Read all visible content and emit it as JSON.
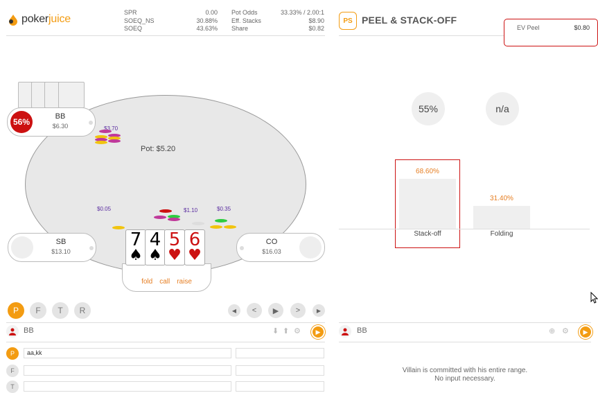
{
  "app": {
    "logo_text_poker": "poker",
    "logo_text_juice": "juice"
  },
  "stats_left": [
    {
      "label": "SPR",
      "value": "0.00"
    },
    {
      "label": "SOEQ_NS",
      "value": "30.88%"
    },
    {
      "label": "SOEQ",
      "value": "43.63%"
    }
  ],
  "stats_right": [
    {
      "label": "Pot Odds",
      "value": "33.33% / 2.00:1"
    },
    {
      "label": "Eff. Stacks",
      "value": "$8.90"
    },
    {
      "label": "Share",
      "value": "$0.82"
    }
  ],
  "table": {
    "pot": "Pot: $5.20",
    "seats": {
      "bb": {
        "name": "BB",
        "stack": "$6.30",
        "equity": "56%"
      },
      "sb": {
        "name": "SB",
        "stack": "$13.10"
      },
      "co": {
        "name": "CO",
        "stack": "$16.03"
      }
    },
    "bets": {
      "bb": "$3.70",
      "sb": "$0.05",
      "mid": "$1.10",
      "co": "$0.35"
    },
    "board": [
      {
        "rank": "7",
        "suit": "♠",
        "color": "#000000"
      },
      {
        "rank": "4",
        "suit": "♠",
        "color": "#000000"
      },
      {
        "rank": "5",
        "suit": "♥",
        "color": "#cc1111"
      },
      {
        "rank": "6",
        "suit": "♥",
        "color": "#cc1111"
      }
    ],
    "actions": {
      "fold": "fold",
      "call": "call",
      "raise": "raise"
    }
  },
  "streets": [
    "P",
    "F",
    "T",
    "R"
  ],
  "left_panel": {
    "player": "BB",
    "ranges": [
      {
        "label": "P",
        "value": "aa,kk"
      },
      {
        "label": "F",
        "value": ""
      },
      {
        "label": "T",
        "value": ""
      }
    ]
  },
  "right_panel": {
    "logo": "PS",
    "title": "PEEL & STACK-OFF",
    "ev_peel_label": "EV Peel",
    "ev_peel_value": "$0.80",
    "circle_left": "55%",
    "circle_right": "n/a",
    "bars": [
      {
        "label": "Stack-off",
        "pct": "68.60%",
        "fraction": 0.686
      },
      {
        "label": "Folding",
        "pct": "31.40%",
        "fraction": 0.314
      }
    ],
    "player": "BB",
    "footer_line1": "Villain is committed with his entire range.",
    "footer_line2": "No input necessary."
  },
  "colors": {
    "accent": "#f39c12",
    "highlight": "#cc1111"
  }
}
